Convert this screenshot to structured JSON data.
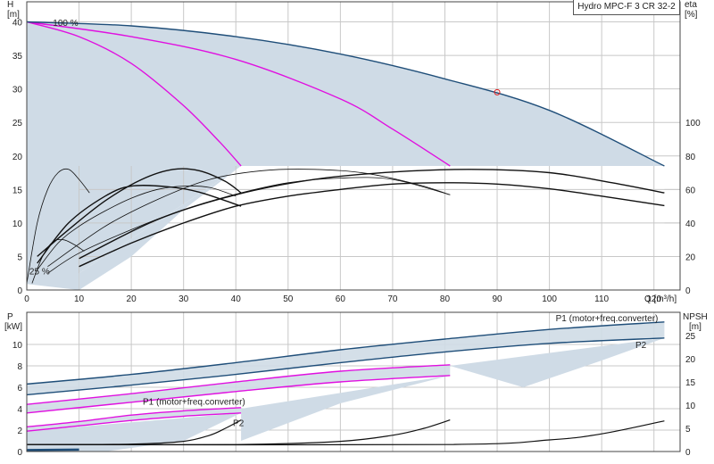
{
  "title": "Hydro MPC-F 3 CR 32-2",
  "colors": {
    "envelope": "#cfdbe6",
    "max_curve": "#1f4e79",
    "pink": "#e010e0",
    "black": "#111111",
    "grid": "#c8c8c8",
    "npsh": "#1f4e79"
  },
  "chart_data": [
    {
      "type": "line",
      "name": "head-eta",
      "xlabel": "Q [m³/h]",
      "ylabel_top": "H",
      "ylabel_unit": "[m]",
      "y2label_top": "eta",
      "y2label_unit": "[%]",
      "xlim": [
        0,
        125
      ],
      "ylim": [
        0,
        43
      ],
      "y2lim": [
        0,
        100
      ],
      "x_ticks": [
        0,
        10,
        20,
        30,
        40,
        50,
        60,
        70,
        80,
        90,
        100,
        110,
        120
      ],
      "y_ticks": [
        0,
        5,
        10,
        15,
        20,
        25,
        30,
        35,
        40
      ],
      "y2_ticks": [
        0,
        20,
        40,
        60,
        80,
        100
      ],
      "grid": true,
      "annotations": [
        {
          "text": "100 %",
          "x": 5,
          "y": 39.8
        },
        {
          "text": "25 %",
          "x": 0.5,
          "y": 2.7
        }
      ],
      "duty_point": {
        "x": 90,
        "y": 29.5
      },
      "head_envelope_max": [
        [
          0,
          40
        ],
        [
          20,
          39.4
        ],
        [
          40,
          37.8
        ],
        [
          60,
          35.2
        ],
        [
          80,
          31.5
        ],
        [
          90,
          29.5
        ],
        [
          100,
          26.8
        ],
        [
          110,
          23.2
        ],
        [
          122,
          18.5
        ]
      ],
      "head_envelope_min_flow": [
        [
          0,
          0.9
        ],
        [
          10,
          0
        ],
        [
          10,
          2.5
        ],
        [
          41,
          18.5
        ]
      ],
      "head_curves": [
        {
          "name": "pump 1",
          "color": "pink",
          "points": [
            [
              0,
              40
            ],
            [
              10,
              37.8
            ],
            [
              20,
              33.8
            ],
            [
              30,
              27.5
            ],
            [
              37,
              22
            ],
            [
              41,
              18.5
            ]
          ]
        },
        {
          "name": "pump 2",
          "color": "pink",
          "points": [
            [
              0,
              40
            ],
            [
              20,
              37.8
            ],
            [
              40,
              34.4
            ],
            [
              60,
              28.5
            ],
            [
              70,
              24
            ],
            [
              81,
              18.5
            ]
          ]
        },
        {
          "name": "pump 3",
          "color": "max",
          "points": [
            [
              0,
              40
            ],
            [
              20,
              39.4
            ],
            [
              40,
              37.8
            ],
            [
              60,
              35.2
            ],
            [
              80,
              31.5
            ],
            [
              100,
              26.8
            ],
            [
              122,
              18.5
            ]
          ]
        }
      ],
      "eta_curves": [
        {
          "points": [
            [
              0,
              1
            ],
            [
              2,
              10
            ],
            [
              4,
              15
            ],
            [
              6,
              17.5
            ],
            [
              8,
              18
            ],
            [
              10,
              16.5
            ],
            [
              12,
              14.5
            ]
          ]
        },
        {
          "points": [
            [
              1,
              1
            ],
            [
              3,
              5
            ],
            [
              5,
              7.2
            ],
            [
              7,
              7.5
            ],
            [
              9,
              6.8
            ],
            [
              11,
              5.8
            ]
          ]
        },
        {
          "points": [
            [
              2,
              3
            ],
            [
              6,
              7
            ],
            [
              10,
              9.5
            ],
            [
              15,
              11.8
            ],
            [
              20,
              13.7
            ],
            [
              25,
              15
            ],
            [
              30,
              15.5
            ],
            [
              35,
              15.3
            ],
            [
              40,
              14
            ]
          ]
        },
        {
          "points": [
            [
              2,
              5
            ],
            [
              8,
              9
            ],
            [
              15,
              13.3
            ],
            [
              22,
              16.5
            ],
            [
              28,
              18
            ],
            [
              33,
              17.8
            ],
            [
              38,
              16.2
            ],
            [
              41,
              14.5
            ]
          ]
        },
        {
          "points": [
            [
              4,
              2.5
            ],
            [
              10,
              5.5
            ],
            [
              20,
              9
            ],
            [
              30,
              12
            ],
            [
              40,
              14.3
            ],
            [
              50,
              16
            ],
            [
              60,
              16.7
            ],
            [
              70,
              16.5
            ],
            [
              81,
              14.2
            ]
          ]
        },
        {
          "points": [
            [
              4,
              3.5
            ],
            [
              15,
              9.5
            ],
            [
              25,
              13.5
            ],
            [
              35,
              16.5
            ],
            [
              45,
              17.8
            ],
            [
              55,
              18
            ],
            [
              65,
              17.4
            ],
            [
              75,
              15.7
            ],
            [
              81,
              14.2
            ]
          ]
        },
        {
          "points": [
            [
              10,
              3.5
            ],
            [
              20,
              7
            ],
            [
              30,
              10
            ],
            [
              40,
              12.5
            ],
            [
              50,
              14
            ],
            [
              60,
              15
            ],
            [
              70,
              15.8
            ],
            [
              80,
              16
            ],
            [
              90,
              15.8
            ],
            [
              100,
              15.1
            ],
            [
              110,
              14
            ],
            [
              122,
              12.6
            ]
          ]
        },
        {
          "points": [
            [
              10,
              4.7
            ],
            [
              25,
              10.5
            ],
            [
              40,
              14.2
            ],
            [
              55,
              16.5
            ],
            [
              70,
              17.6
            ],
            [
              85,
              18
            ],
            [
              100,
              17.5
            ],
            [
              112,
              16
            ],
            [
              122,
              14.5
            ]
          ]
        },
        {
          "points": [
            [
              2,
              4
            ],
            [
              8,
              10
            ],
            [
              15,
              14
            ],
            [
              20,
              15.5
            ],
            [
              27,
              15.4
            ],
            [
              33,
              14.6
            ],
            [
              41,
              12.5
            ]
          ]
        }
      ]
    },
    {
      "type": "line",
      "name": "power-npsh",
      "ylabel_top": "P",
      "ylabel_unit": "[kW]",
      "y2label_top": "NPSH",
      "y2label_unit": "[m]",
      "xlim": [
        0,
        125
      ],
      "ylim": [
        0,
        13
      ],
      "y2lim": [
        0,
        30
      ],
      "y_ticks": [
        0,
        2,
        4,
        6,
        8,
        10
      ],
      "y2_ticks": [
        0,
        5,
        10,
        15,
        20,
        25
      ],
      "grid": true,
      "labels": [
        {
          "text": "P1 (motor+freq.converter)",
          "x": 111,
          "y": 12.5,
          "color": "max"
        },
        {
          "text": "P2",
          "x": 117.5,
          "y": 10,
          "color": "max"
        },
        {
          "text": "P1 (motor+freq.converter)",
          "x": 32,
          "y": 4.7,
          "color": "max"
        },
        {
          "text": "P2",
          "x": 40.5,
          "y": 2.7,
          "color": "max"
        }
      ],
      "power_curves": [
        {
          "name": "P1 3 pumps",
          "color": "max",
          "points": [
            [
              0,
              6.3
            ],
            [
              20,
              7.2
            ],
            [
              40,
              8.3
            ],
            [
              60,
              9.5
            ],
            [
              80,
              10.5
            ],
            [
              100,
              11.4
            ],
            [
              122,
              12.1
            ]
          ]
        },
        {
          "name": "P2 3 pumps",
          "color": "max",
          "points": [
            [
              0,
              5.3
            ],
            [
              20,
              6.2
            ],
            [
              40,
              7.2
            ],
            [
              60,
              8.3
            ],
            [
              80,
              9.3
            ],
            [
              100,
              10.1
            ],
            [
              122,
              10.6
            ]
          ]
        },
        {
          "name": "P1 2 pumps",
          "color": "pink",
          "points": [
            [
              0,
              4.4
            ],
            [
              20,
              5.4
            ],
            [
              40,
              6.5
            ],
            [
              60,
              7.5
            ],
            [
              81,
              8.1
            ]
          ]
        },
        {
          "name": "P2 2 pumps",
          "color": "pink",
          "points": [
            [
              0,
              3.6
            ],
            [
              20,
              4.6
            ],
            [
              40,
              5.6
            ],
            [
              60,
              6.5
            ],
            [
              81,
              7.1
            ]
          ]
        },
        {
          "name": "P1 1 pump",
          "color": "pink",
          "points": [
            [
              0,
              2.3
            ],
            [
              10,
              2.8
            ],
            [
              20,
              3.4
            ],
            [
              30,
              3.8
            ],
            [
              41,
              4.1
            ]
          ]
        },
        {
          "name": "P2 1 pump",
          "color": "pink",
          "points": [
            [
              0,
              1.9
            ],
            [
              10,
              2.4
            ],
            [
              20,
              2.9
            ],
            [
              30,
              3.3
            ],
            [
              41,
              3.6
            ]
          ]
        }
      ],
      "npsh_curves": [
        {
          "points": [
            [
              0,
              1.5
            ],
            [
              20,
              1.6
            ],
            [
              30,
              2.2
            ],
            [
              35,
              3.5
            ],
            [
              38,
              5
            ],
            [
              41,
              6.8
            ]
          ]
        },
        {
          "points": [
            [
              0,
              1.5
            ],
            [
              40,
              1.5
            ],
            [
              60,
              2.2
            ],
            [
              70,
              3.5
            ],
            [
              76,
              5
            ],
            [
              81,
              6.8
            ]
          ]
        },
        {
          "points": [
            [
              0,
              1.5
            ],
            [
              80,
              1.5
            ],
            [
              100,
              2.5
            ],
            [
              110,
              3.8
            ],
            [
              122,
              6.6
            ]
          ]
        },
        {
          "points": [
            [
              0,
              0.3
            ],
            [
              10,
              0.4
            ]
          ]
        }
      ]
    }
  ]
}
